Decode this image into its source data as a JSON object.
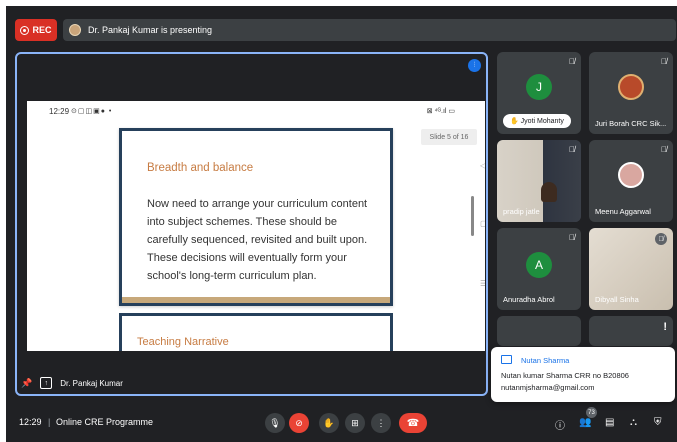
{
  "top_bar": {
    "rec_label": "REC",
    "presenting_text": "Dr. Pankaj Kumar is presenting"
  },
  "presentation": {
    "device_time": "12:29",
    "status_icons": "⊙▢◫▣● •",
    "signal_text": "⊠ ⁴ᴳ.ıl ▭",
    "slide_counter": "Slide 5 of 16",
    "slide_title": "Breadth and balance",
    "slide_body": "Now need to arrange your curriculum content into subject schemes. These should be carefully sequenced, revisited and built upon. These decisions will eventually form your school's long-term curriculum plan.",
    "next_slide_title": "Teaching Narrative",
    "presenter_name": "Dr. Pankaj Kumar"
  },
  "participants": [
    {
      "name": "Jyoti Mohanty",
      "initial": "J",
      "color": "#1e8e3e"
    },
    {
      "name": "Juri Borah CRC Sik..."
    },
    {
      "name": "pradip jatle"
    },
    {
      "name": "Meenu Aggarwal"
    },
    {
      "name": "Anuradha Abrol",
      "initial": "A",
      "color": "#1e8e3e"
    },
    {
      "name": "Dibyall Sinha"
    }
  ],
  "notification": {
    "sender": "Nutan Sharma",
    "line1": "Nutan kumar Sharma CRR no B20806",
    "line2": "nutanmjsharma@gmail.com"
  },
  "bottom_bar": {
    "time": "12:29",
    "separator": "|",
    "meeting_name": "Online CRE Programme",
    "participant_count": "73"
  }
}
